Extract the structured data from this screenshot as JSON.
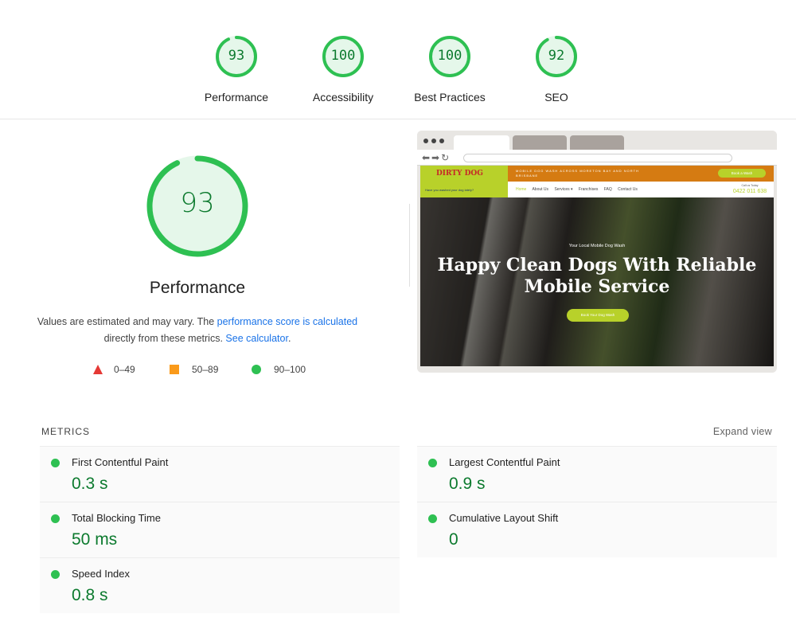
{
  "colors": {
    "pass": "#0c7a2e",
    "pass_fill": "#2ec052",
    "average": "#fa9a1a",
    "fail": "#e53935",
    "link": "#1a73e8"
  },
  "gauges": [
    {
      "label": "Performance",
      "score": "93",
      "value": 93
    },
    {
      "label": "Accessibility",
      "score": "100",
      "value": 100
    },
    {
      "label": "Best Practices",
      "score": "100",
      "value": 100
    },
    {
      "label": "SEO",
      "score": "92",
      "value": 92
    }
  ],
  "main": {
    "score": "93",
    "value": 93,
    "title": "Performance",
    "desc_prefix": "Values are estimated and may vary. The ",
    "desc_link": "performance score is calculated",
    "desc_middle": "directly from these metrics. ",
    "calc_link": "See calculator",
    "desc_suffix": ".",
    "legend": [
      {
        "range": "0–49",
        "icon": "fail-triangle-icon"
      },
      {
        "range": "50–89",
        "icon": "average-square-icon"
      },
      {
        "range": "90–100",
        "icon": "pass-circle-icon"
      }
    ]
  },
  "screenshot": {
    "logo_text": "DIRTY DOG",
    "logo_sub": "Have you washed your dog lately?",
    "top_band": "MOBILE DOG WASH ACROSS MORETON BAY AND NORTH BRISBANE",
    "book_button": "Book a Wash",
    "menu": [
      "Home",
      "About Us",
      "Services ▾",
      "Franchises",
      "FAQ",
      "Contact Us"
    ],
    "call_label": "Call us Today",
    "phone": "0422 011 638",
    "kicker": "Your Local Mobile Dog Wash",
    "headline_line1": "Happy Clean Dogs With Reliable",
    "headline_line2": "Mobile Service",
    "cta": "Book Your Dog Wash"
  },
  "metrics": {
    "heading": "METRICS",
    "expand": "Expand view",
    "items": [
      {
        "name": "First Contentful Paint",
        "value": "0.3 s"
      },
      {
        "name": "Largest Contentful Paint",
        "value": "0.9 s"
      },
      {
        "name": "Total Blocking Time",
        "value": "50 ms"
      },
      {
        "name": "Cumulative Layout Shift",
        "value": "0"
      },
      {
        "name": "Speed Index",
        "value": "0.8 s"
      }
    ]
  }
}
